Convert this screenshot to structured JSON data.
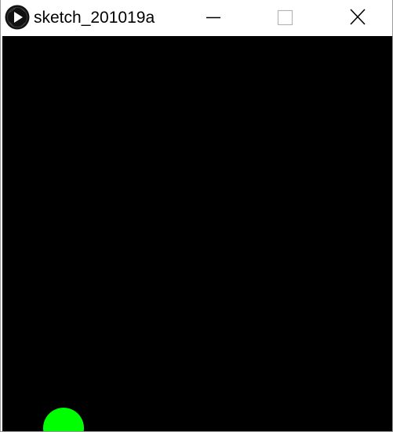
{
  "window": {
    "title": "sketch_201019a",
    "icon": "processing-play-icon",
    "controls": [
      "minimize-icon",
      "maximize-icon",
      "close-icon"
    ]
  },
  "canvas": {
    "background_color": "#000000"
  },
  "ball": {
    "color": "#00ff00"
  }
}
